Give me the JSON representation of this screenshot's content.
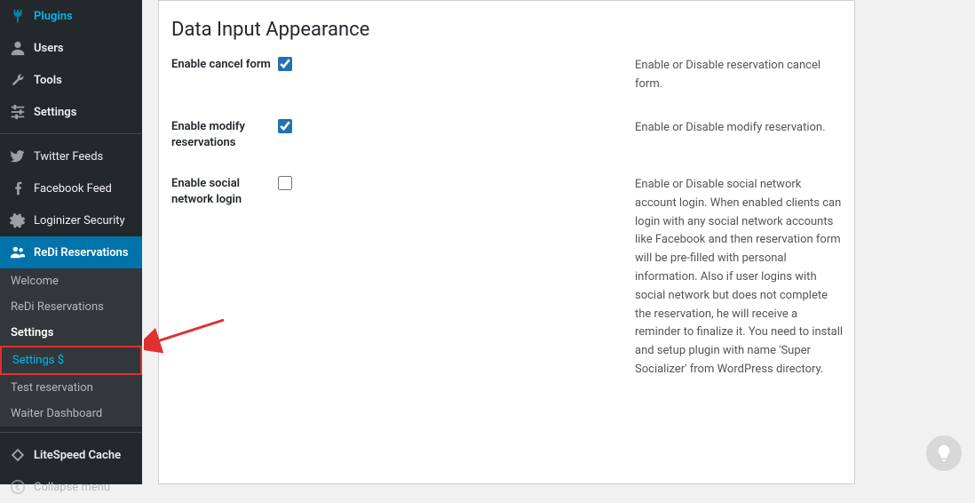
{
  "sidebar": {
    "items": [
      {
        "label": "Plugins",
        "icon": "plug"
      },
      {
        "label": "Users",
        "icon": "user"
      },
      {
        "label": "Tools",
        "icon": "wrench"
      },
      {
        "label": "Settings",
        "icon": "sliders"
      }
    ],
    "items2": [
      {
        "label": "Twitter Feeds",
        "icon": "twitter"
      },
      {
        "label": "Facebook Feed",
        "icon": "facebook"
      },
      {
        "label": "Loginizer Security",
        "icon": "gear"
      },
      {
        "label": "ReDi Reservations",
        "icon": "group"
      }
    ],
    "submenu": [
      {
        "label": "Welcome"
      },
      {
        "label": "ReDi Reservations"
      },
      {
        "label": "Settings"
      },
      {
        "label": "Settings $"
      },
      {
        "label": "Test reservation"
      },
      {
        "label": "Waiter Dashboard"
      }
    ],
    "items3": [
      {
        "label": "LiteSpeed Cache",
        "icon": "diamond"
      }
    ],
    "collapse": "Collapse menu"
  },
  "content": {
    "title": "Data Input Appearance",
    "rows": [
      {
        "label": "Enable cancel form",
        "checked": true,
        "desc": "Enable or Disable reservation cancel form."
      },
      {
        "label": "Enable modify reservations",
        "checked": true,
        "desc": "Enable or Disable modify reservation."
      },
      {
        "label": "Enable social network login",
        "checked": false,
        "desc": "Enable or Disable social network account login. When enabled clients can login with any social network accounts like Facebook and then reservation form will be pre-filled with personal information. Also if user logins with social network but does not complete the reservation, he will receive a reminder to finalize it. You need to install and setup plugin with name 'Super Socializer' from WordPress directory."
      }
    ]
  }
}
